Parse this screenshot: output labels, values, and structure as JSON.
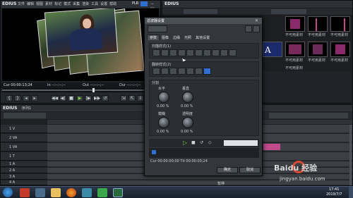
{
  "player": {
    "app_name": "EDIUS",
    "menu": [
      "文件",
      "编辑",
      "视图",
      "素材",
      "标记",
      "模式",
      "采集",
      "渲染",
      "工具",
      "设置",
      "帮助"
    ],
    "mode_badge": "PLR",
    "timecode_cur": "Cur 00:00:13;24",
    "timecode_in": "In --:--:--;--",
    "timecode_out": "Out --:--:--;--",
    "timecode_dur": "Dur --:--:--;--"
  },
  "bin": {
    "app_name": "EDIUS",
    "thumbnails": [
      {
        "label": "不可用素材"
      },
      {
        "label": "不可用素材"
      },
      {
        "label": "不可用素材"
      },
      {
        "label": ""
      },
      {
        "label": "不可用素材"
      },
      {
        "label": "不可用素材"
      },
      {
        "label": "不可用素材"
      },
      {
        "label": "不可用素材"
      }
    ]
  },
  "dialog": {
    "title": "滤波器设置",
    "tabs": [
      "参数",
      "图像",
      "边缘",
      "光照",
      "其他设置"
    ],
    "group1_title": "扫描样式(1)",
    "group2_title": "翻转样式(2)",
    "group3_title": "分割",
    "knob_labels": [
      "水平",
      "垂直",
      "模糊",
      "透明度"
    ],
    "knob_values": [
      "0.00 %",
      "0.00 %",
      "0.00 %",
      "0.00 %"
    ],
    "timecode_row": "Cur 00:00:00;00  Ttl 00:00:03;24",
    "ok_label": "确定",
    "cancel_label": "取消"
  },
  "timeline": {
    "app_name": "EDIUS",
    "sequence": "序列1",
    "tracks": [
      "1 V",
      "2 VA",
      "1 VA",
      "1 T",
      "1 A",
      "2 A",
      "3 A",
      "4 A"
    ]
  },
  "status": {
    "text": "暂停",
    "clock_time": "17:41",
    "clock_date": "2019/7/7"
  },
  "watermark": {
    "brand": "Baidu 经验",
    "url": "jingyan.baidu.com"
  },
  "colors": {
    "accent_blue": "#2f6fd1",
    "selected_pink": "#c04a8a",
    "play_green": "#7cd63a"
  }
}
